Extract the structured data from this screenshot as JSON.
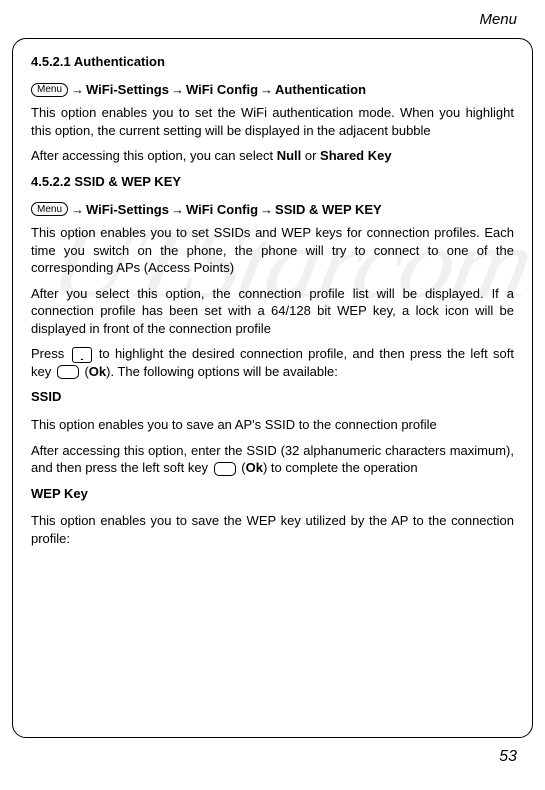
{
  "header": {
    "title": "Menu"
  },
  "watermark": "UTStarcom",
  "s1": {
    "heading": "4.5.2.1 Authentication",
    "crumb1": "WiFi-Settings",
    "crumb2": "WiFi Config",
    "crumb3": "Authentication",
    "p1": "This option enables you to set the WiFi authentication mode. When you highlight this option, the current setting will be displayed in the adjacent bubble",
    "p2_a": "After accessing this option, you can select ",
    "p2_b": "Null",
    "p2_c": " or ",
    "p2_d": "Shared Key"
  },
  "s2": {
    "heading": "4.5.2.2 SSID & WEP KEY",
    "crumb1": "WiFi-Settings",
    "crumb2": "WiFi Config",
    "crumb3": "SSID & WEP KEY",
    "p1": "This option enables you to set SSIDs and WEP keys for connection profiles. Each time you switch on the phone, the phone will try to connect to one of the corresponding APs (Access Points)",
    "p2": "After you select this option, the connection profile list will be displayed. If a connection profile has been set with a 64/128 bit WEP key, a lock icon will be displayed in front of the connection profile",
    "p3_a": "Press ",
    "p3_b": " to highlight the desired connection profile, and then press the left soft key ",
    "p3_c": " (",
    "p3_d": "Ok",
    "p3_e": "). The following options will be available:"
  },
  "ssid": {
    "heading": "SSID",
    "p1": "This option enables you to save an AP's SSID to the connection profile",
    "p2_a": "After accessing this option, enter the SSID (32 alphanumeric characters maximum), and then press the left soft key ",
    "p2_b": " (",
    "p2_c": "Ok",
    "p2_d": ") to complete the operation"
  },
  "wep": {
    "heading": "WEP Key",
    "p1": "This option enables you to save the WEP key utilized by the AP to the connection profile:"
  },
  "pill": "Menu",
  "arrow": "→",
  "page_num": "53"
}
